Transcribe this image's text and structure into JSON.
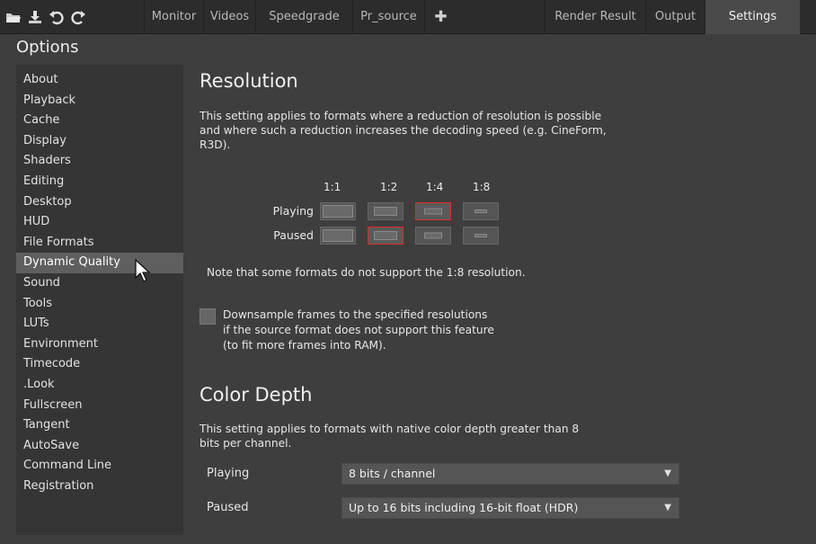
{
  "toolbar": {
    "icons": [
      "folder-open-icon",
      "download-icon",
      "undo-icon",
      "redo-icon"
    ]
  },
  "tabs": [
    {
      "label": "Monitor",
      "active": false
    },
    {
      "label": "Videos",
      "active": false
    },
    {
      "label": "Speedgrade",
      "active": false
    },
    {
      "label": "Pr_source",
      "active": false
    },
    {
      "label": "✚",
      "active": false
    },
    {
      "label": "Render Result",
      "active": false
    },
    {
      "label": "Output",
      "active": false
    },
    {
      "label": "Settings",
      "active": true
    }
  ],
  "options_title": "Options",
  "sidebar": {
    "items": [
      {
        "label": "About"
      },
      {
        "label": "Playback"
      },
      {
        "label": "Cache"
      },
      {
        "label": "Display"
      },
      {
        "label": "Shaders"
      },
      {
        "label": "Editing"
      },
      {
        "label": "Desktop"
      },
      {
        "label": "HUD"
      },
      {
        "label": "File Formats"
      },
      {
        "label": "Dynamic Quality",
        "selected": true
      },
      {
        "label": "Sound"
      },
      {
        "label": "Tools"
      },
      {
        "label": "LUTs"
      },
      {
        "label": "Environment"
      },
      {
        "label": "Timecode"
      },
      {
        "label": ".Look"
      },
      {
        "label": "Fullscreen"
      },
      {
        "label": "Tangent"
      },
      {
        "label": "AutoSave"
      },
      {
        "label": "Command Line"
      },
      {
        "label": "Registration"
      }
    ]
  },
  "resolution": {
    "title": "Resolution",
    "description": "This setting applies to formats where a reduction of resolution is possible and where such a reduction increases the decoding speed (e.g. CineForm, R3D).",
    "columns": [
      "1:1",
      "1:2",
      "1:4",
      "1:8"
    ],
    "rows": [
      {
        "label": "Playing",
        "selected": "1:4"
      },
      {
        "label": "Paused",
        "selected": "1:2"
      }
    ],
    "note": "Note that some formats do not support the 1:8 resolution.",
    "downsample": {
      "checked": false,
      "line1": "Downsample frames to the specified resolutions",
      "line2": "if the source format does not support this feature",
      "line3": "(to fit more frames into RAM)."
    }
  },
  "color_depth": {
    "title": "Color Depth",
    "description": "This setting applies to formats with native color depth greater than 8 bits per channel.",
    "playing_label": "Playing",
    "playing_value": "8 bits / channel",
    "paused_label": "Paused",
    "paused_value": "Up to 16 bits including 16-bit float (HDR)"
  },
  "colors": {
    "accent_selected": "#d6302a",
    "background": "#3e3e3e",
    "active_tab": "#4a4a4a"
  }
}
